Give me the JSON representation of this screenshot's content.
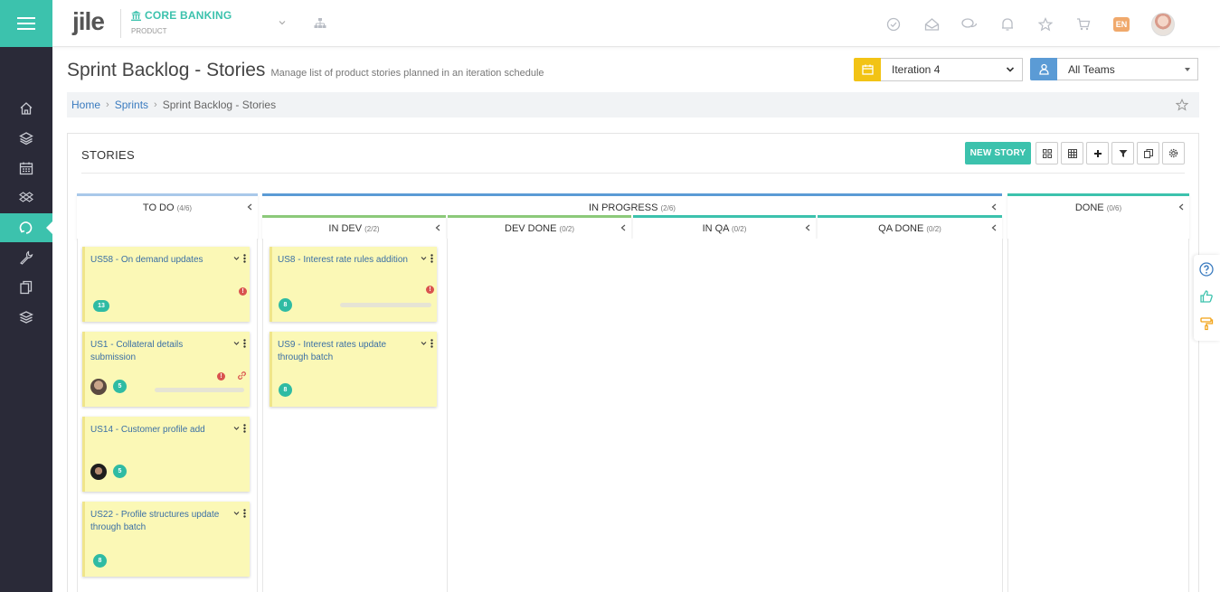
{
  "header": {
    "logo_text": "jile",
    "product_name": "CORE BANKING",
    "product_subtitle": "PRODUCT",
    "language_badge": "EN",
    "icons": [
      "check-circle-icon",
      "inbox-icon",
      "chat-icon",
      "bell-icon",
      "star-icon",
      "cart-icon"
    ]
  },
  "sidebar": {
    "items": [
      {
        "icon": "home-icon"
      },
      {
        "icon": "layers-icon"
      },
      {
        "icon": "calendar-icon"
      },
      {
        "icon": "dropbox-icon"
      },
      {
        "icon": "sprint-cycle-icon",
        "active": true
      },
      {
        "icon": "wrench-icon"
      },
      {
        "icon": "documents-icon"
      },
      {
        "icon": "stack-icon"
      }
    ]
  },
  "page": {
    "title": "Sprint Backlog - Stories",
    "description": "Manage list of product stories planned in an iteration schedule",
    "iteration_selected": "Iteration 4",
    "team_selected": "All Teams"
  },
  "breadcrumb": {
    "items": [
      "Home",
      "Sprints",
      "Sprint Backlog - Stories"
    ]
  },
  "panel": {
    "title": "STORIES",
    "new_story_label": "NEW STORY",
    "toolbar_icons": [
      "card-view-icon",
      "grid-view-icon",
      "plus-icon",
      "filter-icon",
      "copy-icon",
      "settings-icon"
    ]
  },
  "board": {
    "todo": {
      "label": "TO DO",
      "count": "(4/6)"
    },
    "in_progress": {
      "label": "IN PROGRESS",
      "count": "(2/6)"
    },
    "done": {
      "label": "DONE",
      "count": "(0/6)"
    },
    "sub_columns": [
      {
        "label": "IN DEV",
        "count": "(2/2)"
      },
      {
        "label": "DEV DONE",
        "count": "(0/2)"
      },
      {
        "label": "IN QA",
        "count": "(0/2)"
      },
      {
        "label": "QA DONE",
        "count": "(0/2)"
      }
    ],
    "todo_cards": [
      {
        "title": "US58 - On demand updates",
        "points": "13",
        "warning": true
      },
      {
        "title": "US1 - Collateral details submission",
        "points": "5",
        "warning": true,
        "link": true,
        "progress": 0.0
      },
      {
        "title": "US14 - Customer profile add",
        "points": "5"
      },
      {
        "title": "US22 - Profile structures update through batch",
        "points": "8"
      }
    ],
    "indev_cards": [
      {
        "title": "US8 - Interest rate rules addition",
        "points": "8",
        "warning": true,
        "progress": 0.0
      },
      {
        "title": "US9 - Interest rates update through batch",
        "points": "8"
      }
    ]
  },
  "colors": {
    "accent": "#3cc2ad",
    "sidebar_bg": "#2a2a38",
    "iteration_badge": "#f2c315",
    "team_badge": "#5b9bd5",
    "card_bg": "#fbf8b6",
    "todo_border": "#a9c9ea",
    "inprogress_border": "#5b9bd5",
    "indev_border": "#8cc97a",
    "done_border": "#3cc2ad"
  }
}
